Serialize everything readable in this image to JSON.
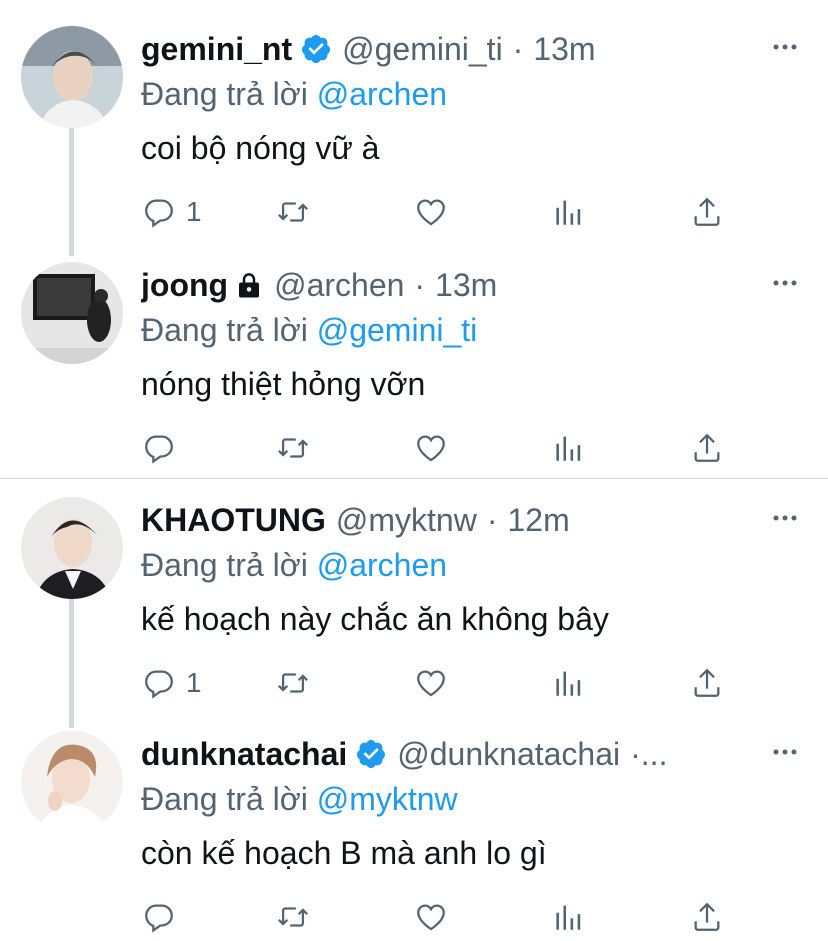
{
  "colors": {
    "accent": "#1d9bf0",
    "muted": "#536471",
    "text": "#0f1419",
    "line": "#cfd9de"
  },
  "reply_prefix": "Đang trả lời",
  "tweets": [
    {
      "name": "gemini_nt",
      "verified": true,
      "locked": false,
      "handle": "@gemini_ti",
      "dot": "·",
      "time": "13m",
      "reply_to": "@archen",
      "text": "coi bộ nóng vữ à",
      "reply_count": "1"
    },
    {
      "name": "joong",
      "verified": false,
      "locked": true,
      "handle": "@archen",
      "dot": "·",
      "time": "13m",
      "reply_to": "@gemini_ti",
      "text": "nóng thiệt hỏng vỡn",
      "reply_count": ""
    },
    {
      "name": "KHAOTUNG",
      "verified": false,
      "locked": false,
      "handle": "@myktnw",
      "dot": "·",
      "time": "12m",
      "reply_to": "@archen",
      "text": "kế hoạch này chắc ăn không bây",
      "reply_count": "1"
    },
    {
      "name": "dunknatachai",
      "verified": true,
      "locked": false,
      "handle": "@dunknatachai",
      "dot": "·...",
      "time": "",
      "reply_to": "@myktnw",
      "text": "còn kế hoạch B mà anh lo gì",
      "reply_count": ""
    }
  ]
}
